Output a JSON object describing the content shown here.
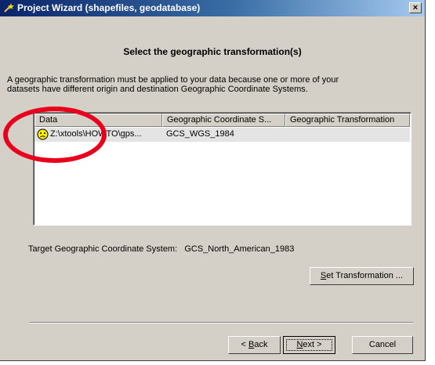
{
  "window": {
    "title": "Project Wizard (shapefiles, geodatabase)",
    "close_label": "×"
  },
  "header": {
    "title": "Select the geographic transformation(s)"
  },
  "description": {
    "line1": "A geographic transformation must be applied to your data because one or more of your",
    "line2": "datasets have different origin and destination Geographic Coordinate Systems."
  },
  "table": {
    "columns": [
      "Data",
      "Geographic Coordinate S...",
      "Geographic Transformation"
    ],
    "rows": [
      {
        "data": "Z:\\xtools\\HOWTO\\gps...",
        "gcs": "GCS_WGS_1984",
        "transformation": "",
        "status_icon": "sad-face-warning-icon"
      }
    ]
  },
  "target": {
    "label": "Target Geographic Coordinate System:",
    "value": "GCS_North_American_1983"
  },
  "buttons": {
    "set_transformation": {
      "mnemonic": "S",
      "rest": "et Transformation ..."
    },
    "back": {
      "prefix": "< ",
      "mnemonic": "B",
      "rest": "ack"
    },
    "next": {
      "mnemonic": "N",
      "rest": "ext >"
    },
    "cancel": "Cancel"
  },
  "colors": {
    "annotation": "#e8001c",
    "titlebar_start": "#0a246a",
    "warning_icon": "#ffee00"
  }
}
